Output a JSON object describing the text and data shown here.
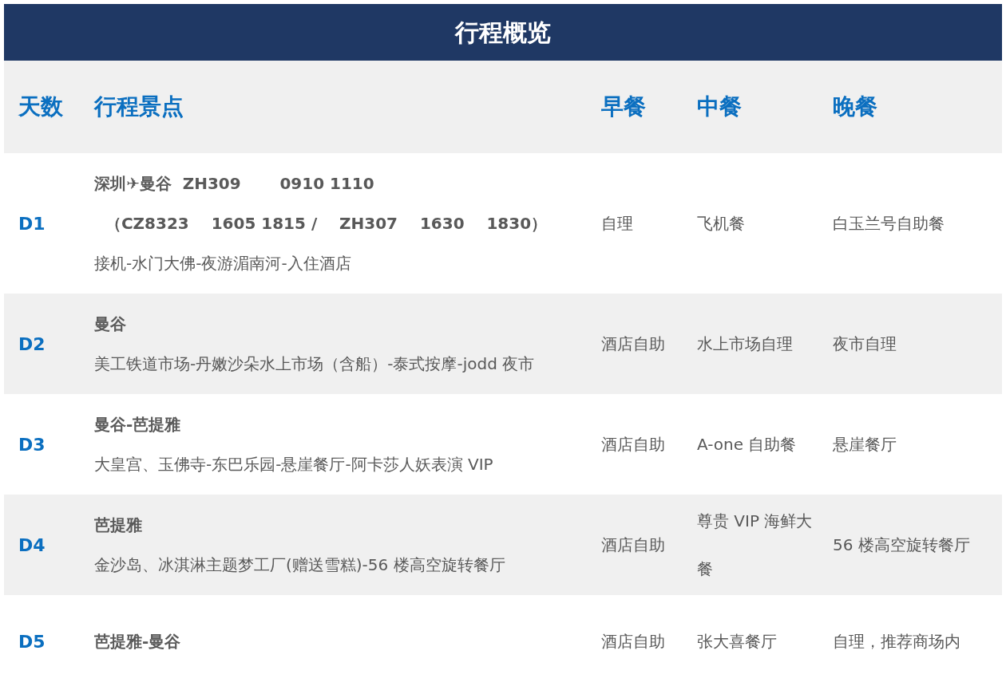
{
  "title": "行程概览",
  "columns": [
    "天数",
    "行程景点",
    "早餐",
    "中餐",
    "晚餐"
  ],
  "rows": [
    {
      "day": "D1",
      "lines": [
        {
          "text": "深圳✈曼谷  ZH309       0910 1110",
          "bold": true
        },
        {
          "text": "  （CZ8323    1605 1815 /    ZH307    1630    1830）",
          "bold": true
        },
        {
          "text": "接机-水门大佛-夜游湄南河-入住酒店",
          "bold": false
        }
      ],
      "breakfast": "自理",
      "lunch": "飞机餐",
      "dinner": "白玉兰号自助餐"
    },
    {
      "day": "D2",
      "lines": [
        {
          "text": "曼谷",
          "bold": true
        },
        {
          "text": "美工铁道市场-丹嫩沙朵水上市场（含船）-泰式按摩-jodd 夜市",
          "bold": false
        }
      ],
      "breakfast": "酒店自助",
      "lunch": "水上市场自理",
      "dinner": "夜市自理"
    },
    {
      "day": "D3",
      "lines": [
        {
          "text": "曼谷-芭提雅",
          "bold": true
        },
        {
          "text": "大皇宫、玉佛寺-东巴乐园-悬崖餐厅-阿卡莎人妖表演 VIP",
          "bold": false
        }
      ],
      "breakfast": "酒店自助",
      "lunch": "A-one 自助餐",
      "dinner": "悬崖餐厅"
    },
    {
      "day": "D4",
      "lines": [
        {
          "text": "芭提雅",
          "bold": true
        },
        {
          "text": "金沙岛、冰淇淋主题梦工厂(赠送雪糕)-56 楼高空旋转餐厅",
          "bold": false
        }
      ],
      "breakfast": "酒店自助",
      "lunch": "尊贵 VIP 海鲜大餐",
      "dinner": "56 楼高空旋转餐厅"
    },
    {
      "day": "D5",
      "lines": [
        {
          "text": "芭提雅-曼谷",
          "bold": true
        }
      ],
      "breakfast": "酒店自助",
      "lunch": "张大喜餐厅",
      "dinner": "自理，推荐商场内"
    }
  ]
}
